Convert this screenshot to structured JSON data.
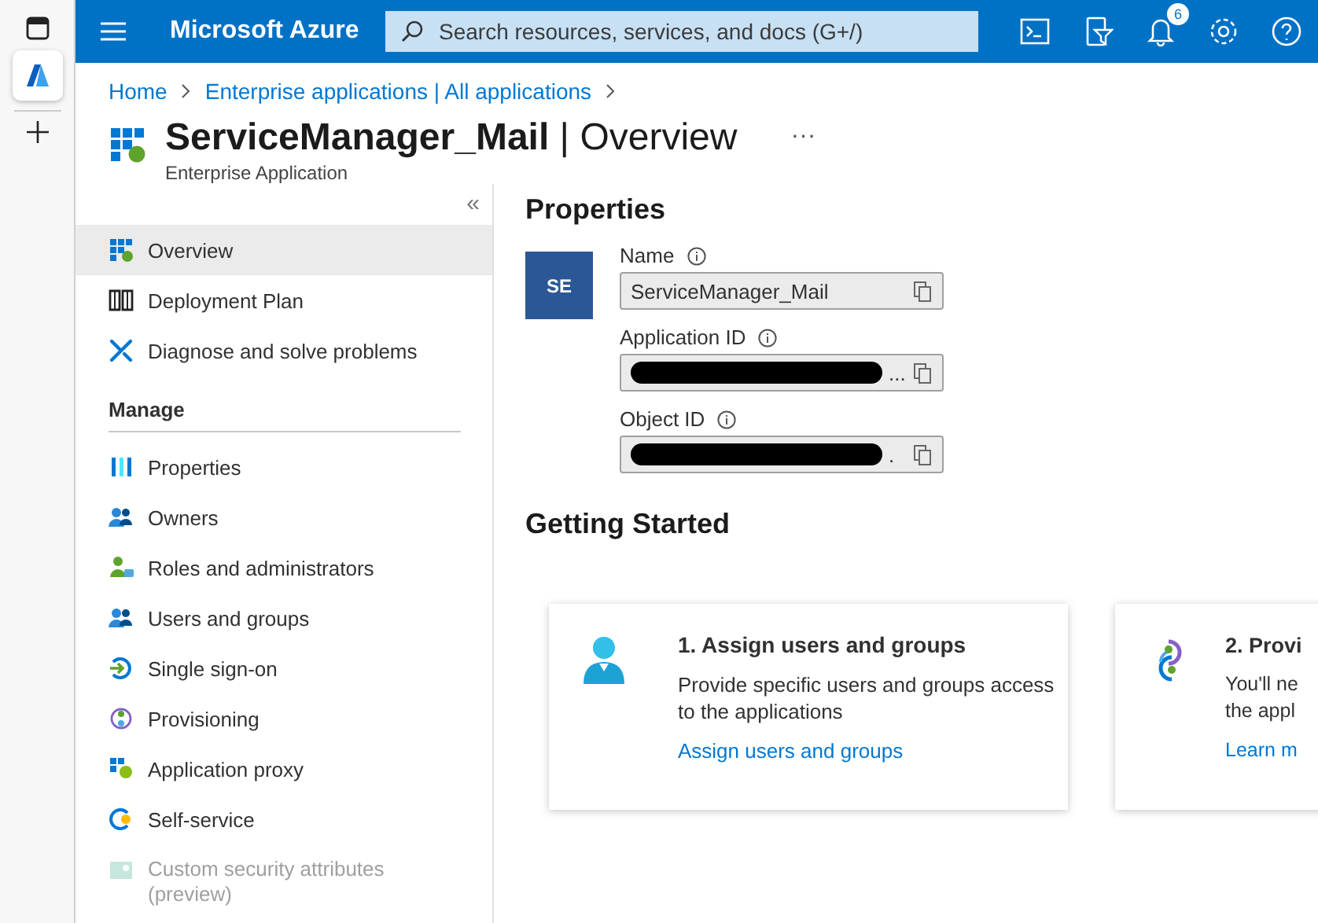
{
  "topbar": {
    "brand": "Microsoft Azure",
    "search": {
      "placeholder": "Search resources, services, and docs (G+/)"
    },
    "notification_count": "6"
  },
  "breadcrumb": [
    "Home",
    "Enterprise applications | All applications"
  ],
  "header": {
    "title": "ServiceManager_Mail",
    "separator": "|",
    "section": "Overview",
    "subtitle": "Enterprise Application",
    "more": "···"
  },
  "sidebar": {
    "collapse": "«",
    "items": [
      {
        "label": "Overview",
        "selected": true,
        "disabled": false
      },
      {
        "label": "Deployment Plan",
        "selected": false,
        "disabled": false
      },
      {
        "label": "Diagnose and solve problems",
        "selected": false,
        "disabled": false
      }
    ],
    "groups": [
      {
        "title": "Manage",
        "items": [
          {
            "label": "Properties",
            "selected": false,
            "disabled": false
          },
          {
            "label": "Owners",
            "selected": false,
            "disabled": false
          },
          {
            "label": "Roles and administrators",
            "selected": false,
            "disabled": false
          },
          {
            "label": "Users and groups",
            "selected": false,
            "disabled": false
          },
          {
            "label": "Single sign-on",
            "selected": false,
            "disabled": false
          },
          {
            "label": "Provisioning",
            "selected": false,
            "disabled": false
          },
          {
            "label": "Application proxy",
            "selected": false,
            "disabled": false
          },
          {
            "label": "Self-service",
            "selected": false,
            "disabled": false
          },
          {
            "label": "Custom security attributes (preview)",
            "selected": false,
            "disabled": true
          }
        ]
      }
    ]
  },
  "properties": {
    "title": "Properties",
    "initials": "SE",
    "fields": [
      {
        "label": "Name",
        "value": "ServiceManager_Mail",
        "redacted": false
      },
      {
        "label": "Application ID",
        "value": "...",
        "redacted": true
      },
      {
        "label": "Object ID",
        "value": ".",
        "redacted": true
      }
    ]
  },
  "getting_started": {
    "title": "Getting Started",
    "cards": [
      {
        "title": "1. Assign users and groups",
        "text": "Provide specific users and groups access to the applications",
        "link": "Assign users and groups"
      },
      {
        "title": "2. Provi",
        "text_lines": [
          "You'll ne",
          "the appl"
        ],
        "link": "Learn m"
      }
    ]
  }
}
